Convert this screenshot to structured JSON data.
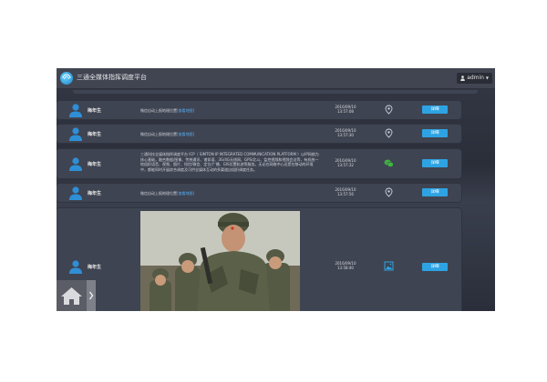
{
  "header": {
    "app_title": "三通全媒体指挥调度平台",
    "user_label": "admin"
  },
  "messages": [
    {
      "sender": "梅年生",
      "text": "微信自动上报地理位置",
      "link": "[查看地图]",
      "date": "2016/09/10",
      "time": "13:57:08",
      "type_icon": "location-pin-icon",
      "button": "详细"
    },
    {
      "sender": "梅年生",
      "text": "微信自动上报地理位置",
      "link": "[查看地图]",
      "date": "2016/09/10",
      "time": "13:57:30",
      "type_icon": "location-pin-icon",
      "button": "详细"
    },
    {
      "sender": "梅年生",
      "text": "三通科技全媒体指挥调度平台 ICP（ SIMTON IP INTEGRATED COMMUNICATION PLATFORM ）以IP网络为核心基础，融合数据/图像、传统通讯、诸如语、3G/4G无线网、GPS/北斗、监控视频和视频会议等，有机统一地组织语音、视频、图片、短信/微信、定位/广播、GIS位置轨迹等服务。无论在网络中心还是在移动的环境中，都能同时开展综合调度及可供全媒体互动的多渠道自组织调度任务。",
      "link": "",
      "date": "2016/09/10",
      "time": "13:57:32",
      "type_icon": "wechat-icon",
      "button": "详细"
    },
    {
      "sender": "梅年生",
      "text": "微信自动上报地理位置",
      "link": "[查看地图]",
      "date": "2016/09/10",
      "time": "13:57:56",
      "type_icon": "location-pin-icon",
      "button": "详细"
    },
    {
      "sender": "梅年生",
      "text": "",
      "link": "",
      "date": "2016/09/10",
      "time": "13:58:40",
      "type_icon": "image-icon",
      "button": "详细"
    }
  ],
  "colors": {
    "accent": "#2ea3e3",
    "row_bg": "#3f4452",
    "topbar": "#414552"
  },
  "footer": {
    "home_icon": "home-icon",
    "expand_icon": "chevron-right-icon"
  }
}
